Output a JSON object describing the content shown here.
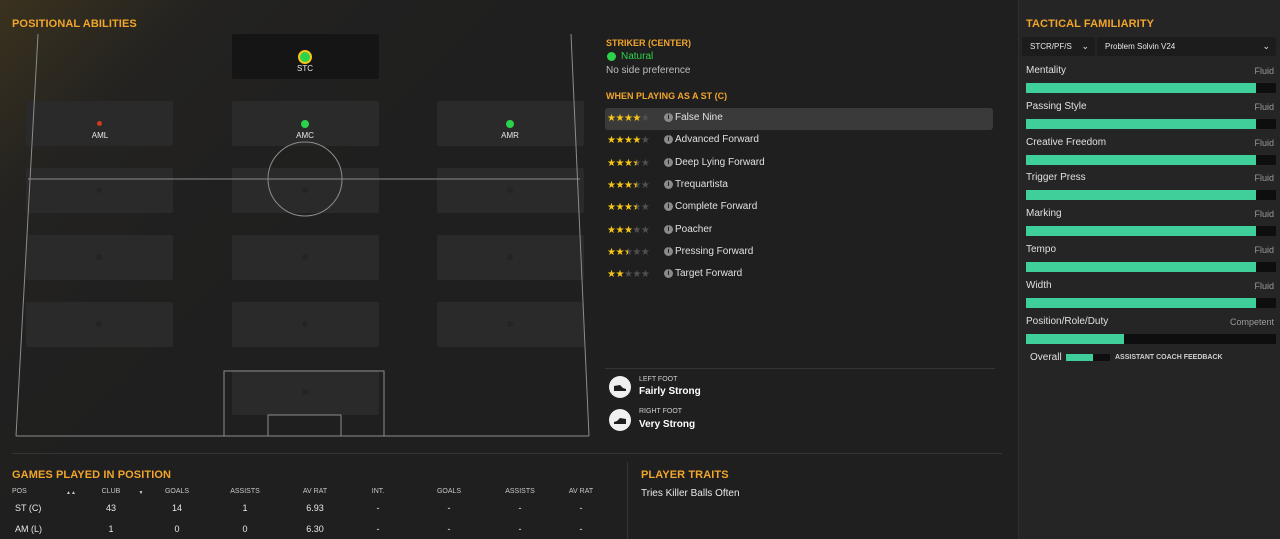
{
  "colors": {
    "accent": "#f2a52b",
    "natural": "#2bd34a",
    "poor": "#d23a1c",
    "bar": "#3ecf9a",
    "star": "#f5c518"
  },
  "positional": {
    "title": "POSITIONAL ABILITIES",
    "positions": [
      {
        "label": "STC",
        "rating": "natural"
      },
      {
        "label": "AML",
        "rating": "poor"
      },
      {
        "label": "AMC",
        "rating": "natural"
      },
      {
        "label": "AMR",
        "rating": "natural"
      }
    ]
  },
  "details": {
    "position_title": "STRIKER (CENTER)",
    "familiarity": "Natural",
    "side_pref": "No side preference",
    "roles_title": "WHEN PLAYING AS A ST (C)",
    "roles": [
      {
        "name": "False Nine",
        "stars": 4
      },
      {
        "name": "Advanced Forward",
        "stars": 4
      },
      {
        "name": "Deep Lying Forward",
        "stars": 3.5
      },
      {
        "name": "Trequartista",
        "stars": 3.5
      },
      {
        "name": "Complete Forward",
        "stars": 3.5
      },
      {
        "name": "Poacher",
        "stars": 3
      },
      {
        "name": "Pressing Forward",
        "stars": 2.5
      },
      {
        "name": "Target Forward",
        "stars": 2
      }
    ],
    "left_foot_label": "LEFT FOOT",
    "left_foot_value": "Fairly Strong",
    "right_foot_label": "RIGHT FOOT",
    "right_foot_value": "Very Strong"
  },
  "games": {
    "title": "GAMES PLAYED IN POSITION",
    "headers": [
      "POS",
      "CLUB",
      "GOALS",
      "ASSISTS",
      "AV RAT",
      "INT.",
      "GOALS",
      "ASSISTS",
      "AV RAT"
    ],
    "rows": [
      [
        "ST (C)",
        "43",
        "14",
        "1",
        "6.93",
        "-",
        "-",
        "-",
        "-"
      ],
      [
        "AM (L)",
        "1",
        "0",
        "0",
        "6.30",
        "-",
        "-",
        "-",
        "-"
      ]
    ]
  },
  "traits": {
    "title": "PLAYER TRAITS",
    "items": [
      "Tries Killer Balls Often"
    ]
  },
  "tactical": {
    "title": "TACTICAL FAMILIARITY",
    "role_select": "STCR/PF/S",
    "tactic_select": "Problem Solvin V24",
    "items": [
      {
        "name": "Mentality",
        "value": "Fluid",
        "level": 0.92
      },
      {
        "name": "Passing Style",
        "value": "Fluid",
        "level": 0.92
      },
      {
        "name": "Creative Freedom",
        "value": "Fluid",
        "level": 0.92
      },
      {
        "name": "Trigger Press",
        "value": "Fluid",
        "level": 0.92
      },
      {
        "name": "Marking",
        "value": "Fluid",
        "level": 0.92
      },
      {
        "name": "Tempo",
        "value": "Fluid",
        "level": 0.92
      },
      {
        "name": "Width",
        "value": "Fluid",
        "level": 0.92
      },
      {
        "name": "Position/Role/Duty",
        "value": "Competent",
        "level": 0.39
      }
    ],
    "overall_label": "Overall",
    "overall_level": 0.62,
    "feedback_label": "ASSISTANT COACH FEEDBACK"
  }
}
